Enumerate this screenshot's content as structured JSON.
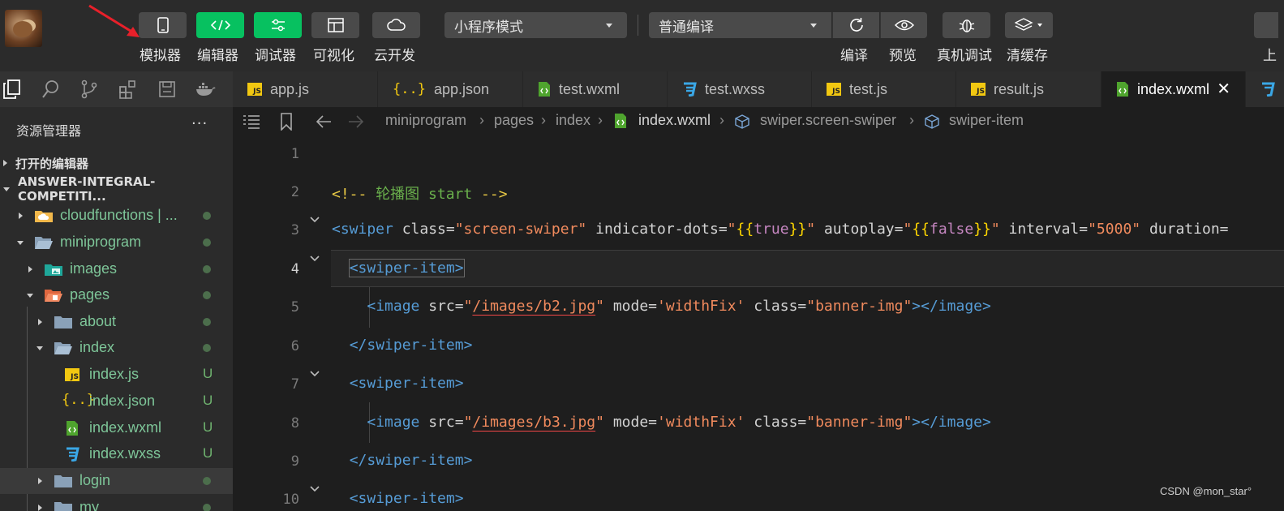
{
  "toolbar": {
    "buttons": [
      {
        "label": "模拟器"
      },
      {
        "label": "编辑器"
      },
      {
        "label": "调试器"
      },
      {
        "label": "可视化"
      },
      {
        "label": "云开发"
      }
    ],
    "mode_select": "小程序模式",
    "compile_select": "普通编译",
    "right_buttons": [
      {
        "label": "编译"
      },
      {
        "label": "预览"
      },
      {
        "label": "真机调试"
      },
      {
        "label": "清缓存"
      }
    ],
    "edge_label": "上"
  },
  "tabs": [
    {
      "label": "app.js",
      "type": "js"
    },
    {
      "label": "app.json",
      "type": "json"
    },
    {
      "label": "test.wxml",
      "type": "wxml"
    },
    {
      "label": "test.wxss",
      "type": "wxss"
    },
    {
      "label": "test.js",
      "type": "js"
    },
    {
      "label": "result.js",
      "type": "js"
    },
    {
      "label": "index.wxml",
      "type": "wxml",
      "active": true
    }
  ],
  "sidebar": {
    "title": "资源管理器",
    "more": "···",
    "sections": [
      "打开的编辑器",
      "ANSWER-INTEGRAL-COMPETITI..."
    ],
    "tree": [
      {
        "label": "cloudfunctions | ...",
        "badge": ""
      },
      {
        "label": "miniprogram",
        "badge": ""
      },
      {
        "label": "images",
        "badge": ""
      },
      {
        "label": "pages",
        "badge": ""
      },
      {
        "label": "about",
        "badge": ""
      },
      {
        "label": "index",
        "badge": ""
      },
      {
        "label": "index.js",
        "badge": "U"
      },
      {
        "label": "index.json",
        "badge": "U"
      },
      {
        "label": "index.wxml",
        "badge": "U"
      },
      {
        "label": "index.wxss",
        "badge": "U"
      },
      {
        "label": "login",
        "badge": ""
      },
      {
        "label": "my",
        "badge": ""
      }
    ]
  },
  "breadcrumb": [
    "miniprogram",
    "pages",
    "index",
    "index.wxml",
    "swiper.screen-swiper",
    "swiper-item"
  ],
  "editor": {
    "line_numbers": [
      "1",
      "2",
      "3",
      "4",
      "5",
      "6",
      "7",
      "8",
      "9",
      "10"
    ],
    "current_line": "4",
    "l2": {
      "open": "<!-- ",
      "text": "轮播图 start",
      "close": " -->"
    },
    "l3": {
      "tag_open": "<swiper",
      "a1": " class=",
      "v1": "\"screen-swiper\"",
      "a2": " indicator-dots=",
      "q": "\"",
      "b1": "{{",
      "bool1": "true",
      "b2": "}}",
      "a3": " autoplay=",
      "bool2": "false",
      "a4": " interval=",
      "v4": "\"5000\"",
      "a5": " duration="
    },
    "l4": {
      "tag": "<swiper-item>"
    },
    "l5": {
      "tag": "<image",
      "a1": " src=",
      "q": "\"",
      "url": "/images/b2.jpg",
      "a2": " mode=",
      "v2": "'widthFix'",
      "a3": " class=",
      "v3": "\"banner-img\"",
      "end": "></image>"
    },
    "l6": {
      "tag": "</swiper-item>"
    },
    "l7": {
      "tag": "<swiper-item>"
    },
    "l8": {
      "url": "/images/b3.jpg"
    },
    "l9": {
      "tag": "</swiper-item>"
    },
    "l10": {
      "tag": "<swiper-item>"
    }
  },
  "watermark": "CSDN @mon_star°"
}
